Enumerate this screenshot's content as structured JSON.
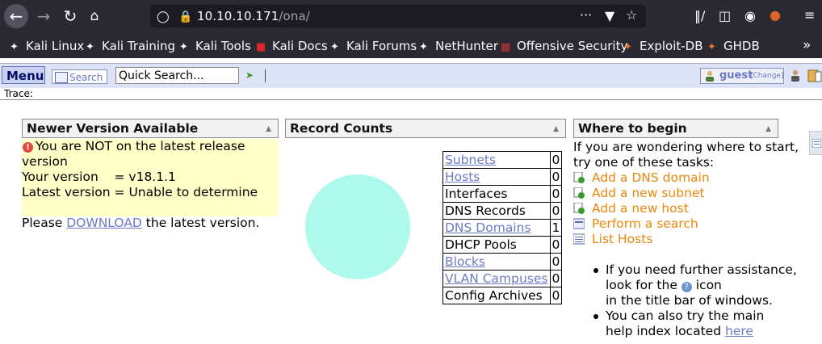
{
  "browser": {
    "url_host": "10.10.10.171",
    "url_path": "/ona/",
    "bookmarks": [
      "Kali Linux",
      "Kali Training",
      "Kali Tools",
      "Kali Docs",
      "Kali Forums",
      "NetHunter",
      "Offensive Security",
      "Exploit-DB",
      "GHDB"
    ],
    "overflow": "»"
  },
  "app": {
    "menu_label": "Menu",
    "search_label": "Search",
    "quick_search_value": "Quick Search...",
    "user": "guest",
    "change_label": "[Change]",
    "trace_label": "Trace:"
  },
  "newer": {
    "title": "Newer Version Available",
    "line1": "You are NOT on the latest release version",
    "line2": "Your version    = v18.1.1",
    "line3": "Latest version = Unable to determine",
    "please": "Please",
    "download": "DOWNLOAD",
    "rest": "the latest version."
  },
  "records": {
    "title": "Record Counts",
    "rows": [
      {
        "label": "Subnets",
        "count": "0",
        "link": true
      },
      {
        "label": "Hosts",
        "count": "0",
        "link": true
      },
      {
        "label": "Interfaces",
        "count": "0",
        "link": false
      },
      {
        "label": "DNS Records",
        "count": "0",
        "link": false
      },
      {
        "label": "DNS Domains",
        "count": "1",
        "link": true
      },
      {
        "label": "DHCP Pools",
        "count": "0",
        "link": false
      },
      {
        "label": "Blocks",
        "count": "0",
        "link": true
      },
      {
        "label": "VLAN Campuses",
        "count": "0",
        "link": true
      },
      {
        "label": "Config Archives",
        "count": "0",
        "link": false
      }
    ],
    "pie_color": "#adfaec"
  },
  "where": {
    "title": "Where to begin",
    "intro1": "If you are wondering where to start,",
    "intro2": "try one of these tasks:",
    "tasks": [
      "Add a DNS domain",
      "Add a new subnet",
      "Add a new host",
      "Perform a search",
      "List Hosts"
    ],
    "bullet1_a": "If you need further assistance,",
    "bullet1_b": "look for the",
    "bullet1_c": "icon",
    "bullet1_d": "in the title bar of windows.",
    "bullet2_a": "You can also try the main",
    "bullet2_b": "help index located",
    "here": "here"
  }
}
